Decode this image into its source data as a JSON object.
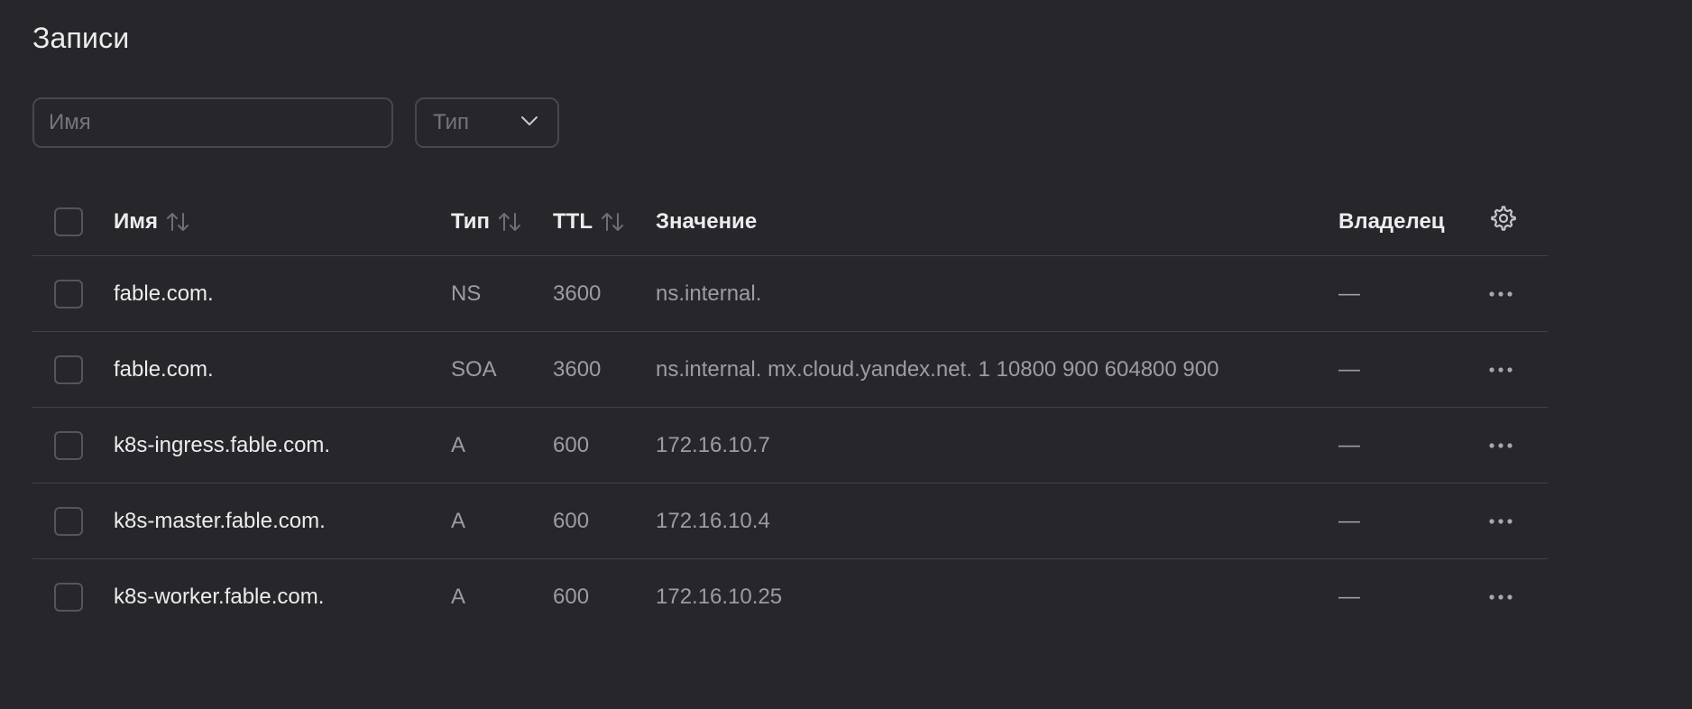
{
  "page": {
    "title": "Записи"
  },
  "filters": {
    "name_placeholder": "Имя",
    "type_placeholder": "Тип"
  },
  "table": {
    "headers": {
      "name": "Имя",
      "type": "Тип",
      "ttl": "TTL",
      "value": "Значение",
      "owner": "Владелец"
    },
    "rows": [
      {
        "name": "fable.com.",
        "type": "NS",
        "ttl": "3600",
        "value": "ns.internal.",
        "owner": "—"
      },
      {
        "name": "fable.com.",
        "type": "SOA",
        "ttl": "3600",
        "value": "ns.internal. mx.cloud.yandex.net. 1 10800 900 604800 900",
        "owner": "—"
      },
      {
        "name": "k8s-ingress.fable.com.",
        "type": "A",
        "ttl": "600",
        "value": "172.16.10.7",
        "owner": "—"
      },
      {
        "name": "k8s-master.fable.com.",
        "type": "A",
        "ttl": "600",
        "value": "172.16.10.4",
        "owner": "—"
      },
      {
        "name": "k8s-worker.fable.com.",
        "type": "A",
        "ttl": "600",
        "value": "172.16.10.25",
        "owner": "—"
      }
    ]
  },
  "icons": {
    "sort": "sort-arrows-icon",
    "settings": "gear-icon",
    "row_menu": "more-horizontal-icon",
    "dropdown": "chevron-down-icon"
  },
  "colors": {
    "background": "#27262b",
    "text_primary": "#ececee",
    "text_secondary": "#9d9ca2",
    "border": "#48474d"
  }
}
